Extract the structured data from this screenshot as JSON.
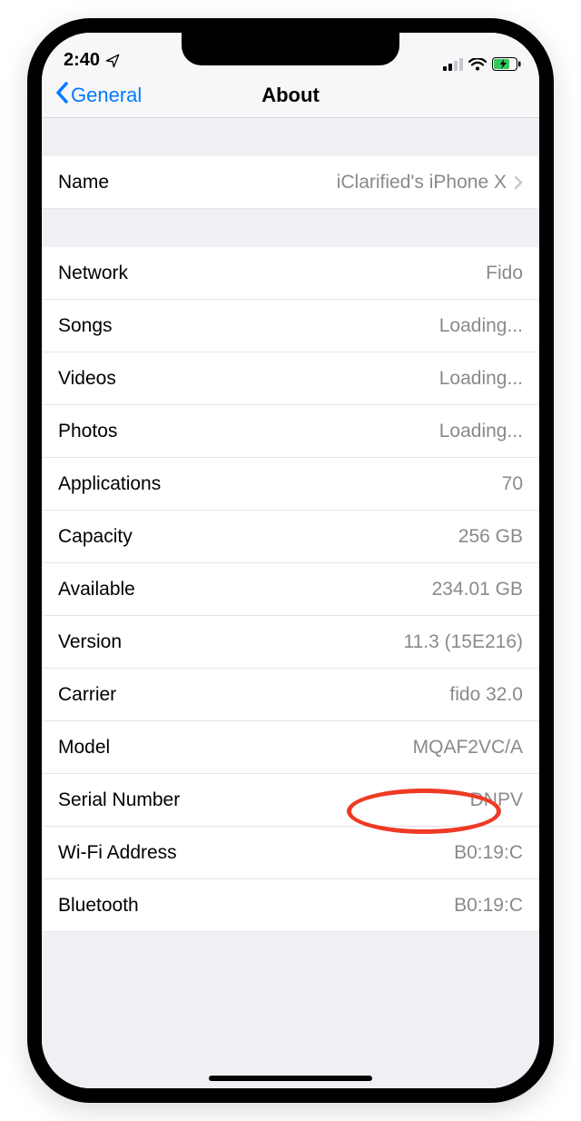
{
  "status": {
    "time": "2:40",
    "location_icon": "location-arrow",
    "cell_icon": "cell-signal",
    "wifi_icon": "wifi",
    "battery_icon": "battery-charging"
  },
  "nav": {
    "back_label": "General",
    "title": "About"
  },
  "sections": {
    "name": {
      "label": "Name",
      "value": "iClarified's iPhone X"
    },
    "details": [
      {
        "key": "network",
        "label": "Network",
        "value": "Fido"
      },
      {
        "key": "songs",
        "label": "Songs",
        "value": "Loading..."
      },
      {
        "key": "videos",
        "label": "Videos",
        "value": "Loading..."
      },
      {
        "key": "photos",
        "label": "Photos",
        "value": "Loading..."
      },
      {
        "key": "applications",
        "label": "Applications",
        "value": "70"
      },
      {
        "key": "capacity",
        "label": "Capacity",
        "value": "256 GB"
      },
      {
        "key": "available",
        "label": "Available",
        "value": "234.01 GB"
      },
      {
        "key": "version",
        "label": "Version",
        "value": "11.3 (15E216)"
      },
      {
        "key": "carrier",
        "label": "Carrier",
        "value": "fido 32.0"
      },
      {
        "key": "model",
        "label": "Model",
        "value": "MQAF2VC/A"
      },
      {
        "key": "serial",
        "label": "Serial Number",
        "value": "DNPV"
      },
      {
        "key": "wifi",
        "label": "Wi-Fi Address",
        "value": "B0:19:C"
      },
      {
        "key": "bluetooth",
        "label": "Bluetooth",
        "value": "B0:19:C"
      }
    ]
  }
}
